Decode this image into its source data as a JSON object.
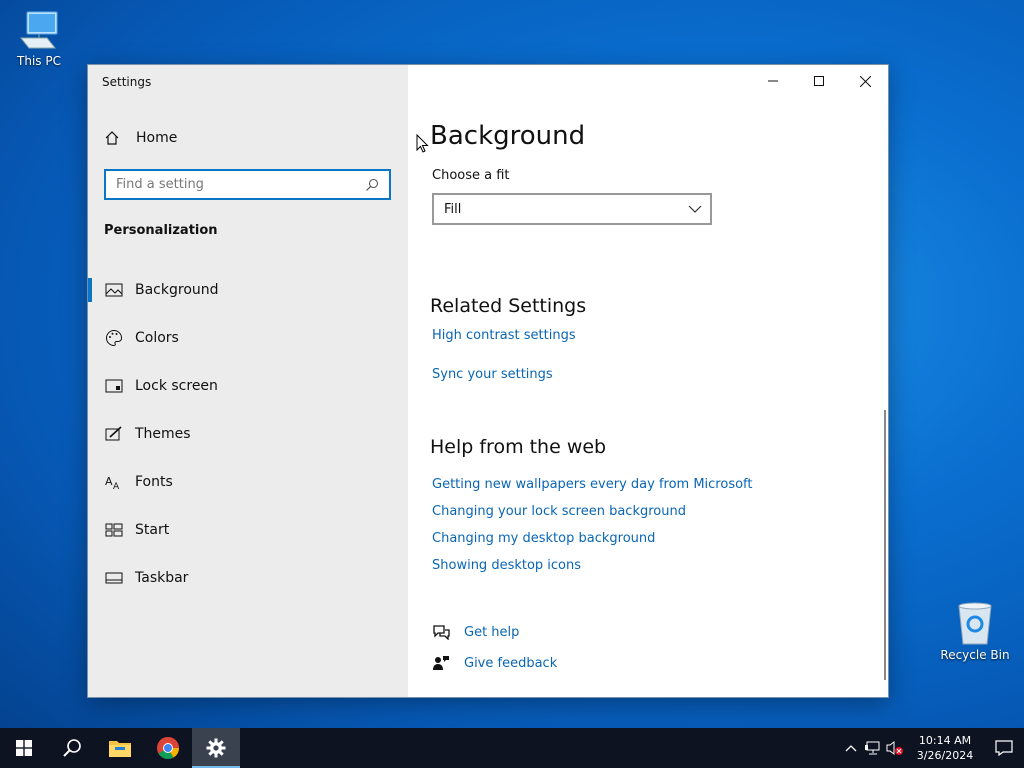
{
  "desktop": {
    "icons": [
      {
        "label": "This PC"
      },
      {
        "label": "Recycle Bin"
      }
    ]
  },
  "window": {
    "title": "Settings",
    "sidebar": {
      "home_label": "Home",
      "search_placeholder": "Find a setting",
      "section_title": "Personalization",
      "items": [
        {
          "label": "Background",
          "icon": "picture-icon",
          "selected": true
        },
        {
          "label": "Colors",
          "icon": "palette-icon"
        },
        {
          "label": "Lock screen",
          "icon": "lock-screen-icon"
        },
        {
          "label": "Themes",
          "icon": "themes-brush-icon"
        },
        {
          "label": "Fonts",
          "icon": "fonts-icon"
        },
        {
          "label": "Start",
          "icon": "start-grid-icon"
        },
        {
          "label": "Taskbar",
          "icon": "taskbar-icon"
        }
      ]
    },
    "content": {
      "title": "Background",
      "fit_label": "Choose a fit",
      "fit_value": "Fill",
      "related": {
        "heading": "Related Settings",
        "links": [
          "High contrast settings",
          "Sync your settings"
        ]
      },
      "help": {
        "heading": "Help from the web",
        "links": [
          "Getting new wallpapers every day from Microsoft",
          "Changing your lock screen background",
          "Changing my desktop background",
          "Showing desktop icons"
        ]
      },
      "get_help": "Get help",
      "give_feedback": "Give feedback"
    }
  },
  "taskbar": {
    "time": "10:14 AM",
    "date": "3/26/2024"
  },
  "colors": {
    "accent": "#0a76c4",
    "link": "#0a66b4",
    "taskbar": "#0d1320"
  }
}
